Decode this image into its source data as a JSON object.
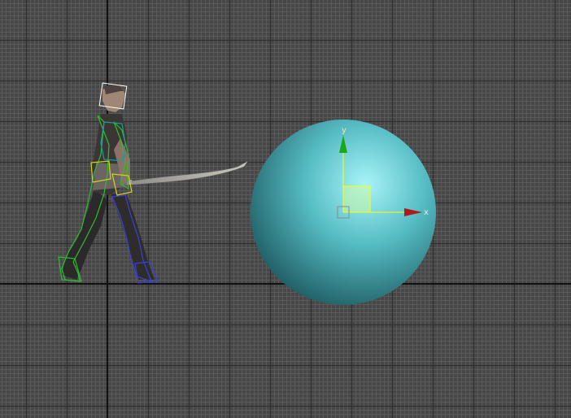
{
  "viewport": {
    "background_color": "#474747",
    "grid_major_color": "#2e2e2e",
    "grid_minor_color": "#5a5a5a",
    "world_axis_color": "#111111"
  },
  "sphere": {
    "color_light": "#a8f4f8",
    "color_mid": "#56bcc4",
    "color_dark": "#1d5a60"
  },
  "gizmo": {
    "y_label": "y",
    "x_label": "x",
    "y_color": "#1aa81a",
    "x_color": "#b01a1a",
    "plane_color": "#c9f7a5",
    "line_color": "#ffff00"
  },
  "character": {
    "selection_color": "#ffffff",
    "bone_colors": [
      "#2ebd2e",
      "#3a40d8",
      "#1e9aa0",
      "#d8d020"
    ]
  }
}
